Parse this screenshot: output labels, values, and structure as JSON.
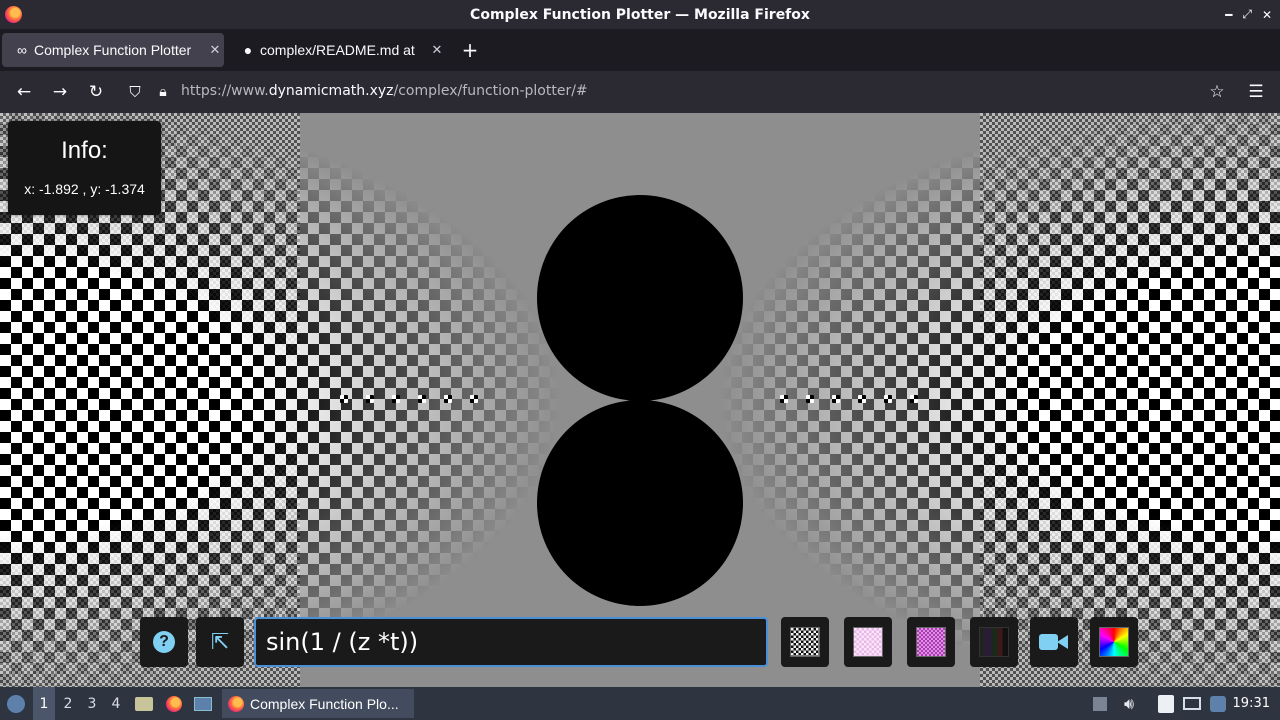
{
  "window": {
    "title": "Complex Function Plotter — Mozilla Firefox"
  },
  "tabs": [
    {
      "label": "Complex Function Plotter",
      "icon": "infinity-icon",
      "active": true
    },
    {
      "label": "complex/README.md at",
      "icon": "github-icon",
      "active": false
    }
  ],
  "navbar": {
    "url_prefix": "https://www.",
    "url_host": "dynamicmath.xyz",
    "url_path": "/complex/function-plotter/#"
  },
  "info": {
    "title": "Info:",
    "coords": "x: -1.892 , y: -1.374"
  },
  "controls": {
    "formula": "sin(1 / (z *t))",
    "help_icon": "?",
    "swatches": [
      "checker-bw",
      "checker-pink",
      "checker-purple",
      "dark-stripes",
      "video-camera",
      "color-wheel"
    ]
  },
  "taskbar": {
    "workspaces": [
      "1",
      "2",
      "3",
      "4"
    ],
    "active_window": "Complex Function Plo...",
    "time": "19:31"
  },
  "colors": {
    "accent": "#7fd0f2",
    "formula_border": "#4a90d9",
    "plot_background": "#8e8e8e"
  }
}
